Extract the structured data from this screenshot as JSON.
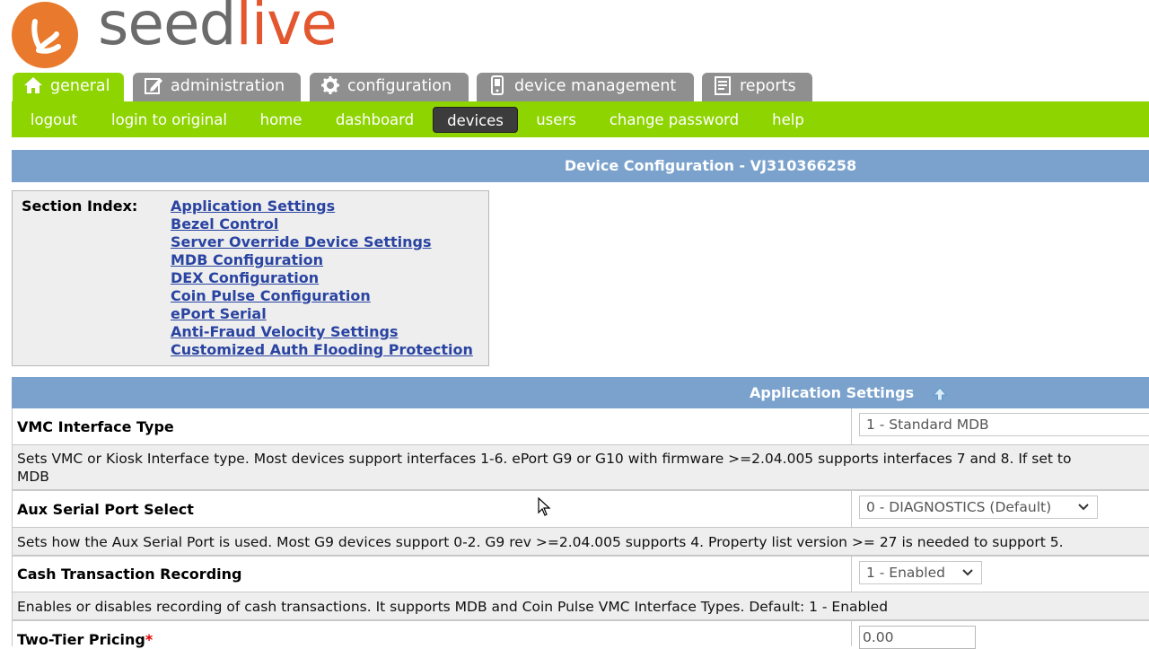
{
  "brand": {
    "part1": "seed",
    "part2": "live",
    "colors": {
      "orange": "#e97a2d",
      "green": "#8ed400",
      "blue": "#7aa2cd"
    }
  },
  "tabs": [
    {
      "label": "general",
      "icon": "home-icon",
      "active": true
    },
    {
      "label": "administration",
      "icon": "edit-icon",
      "active": false
    },
    {
      "label": "configuration",
      "icon": "gear-icon",
      "active": false
    },
    {
      "label": "device management",
      "icon": "device-icon",
      "active": false
    },
    {
      "label": "reports",
      "icon": "report-icon",
      "active": false
    }
  ],
  "subnav": [
    {
      "label": "logout"
    },
    {
      "label": "login to original"
    },
    {
      "label": "home"
    },
    {
      "label": "dashboard"
    },
    {
      "label": "devices",
      "current": true
    },
    {
      "label": "users"
    },
    {
      "label": "change password"
    },
    {
      "label": "help"
    }
  ],
  "page": {
    "title": "Device Configuration - VJ310366258"
  },
  "section_index": {
    "label": "Section Index:",
    "links": [
      "Application Settings",
      "Bezel Control",
      "Server Override Device Settings",
      "MDB Configuration",
      "DEX Configuration",
      "Coin Pulse Configuration",
      "ePort Serial",
      "Anti-Fraud Velocity Settings",
      "Customized Auth Flooding Protection"
    ]
  },
  "section": {
    "title": "Application Settings"
  },
  "settings": [
    {
      "label": "VMC Interface Type",
      "value": "1 - Standard MDB",
      "desc1": "Sets VMC or Kiosk Interface type. Most devices support interfaces 1-6. ePort G9 or G10 with firmware >=2.04.005 supports interfaces 7 and 8. If set to",
      "desc2": "MDB"
    },
    {
      "label": "Aux Serial Port Select",
      "value": "0 - DIAGNOSTICS (Default)",
      "desc1": "Sets how the Aux Serial Port is used. Most G9 devices support 0-2. G9 rev >=2.04.005 supports 4. Property list version >= 27 is needed to support 5."
    },
    {
      "label": "Cash Transaction Recording",
      "value": "1 - Enabled",
      "desc1": "Enables or disables recording of cash transactions. It supports MDB and Coin Pulse VMC Interface Types. Default: 1 - Enabled"
    },
    {
      "label": "Two-Tier Pricing",
      "required_mark": "*",
      "value": "0.00"
    }
  ]
}
